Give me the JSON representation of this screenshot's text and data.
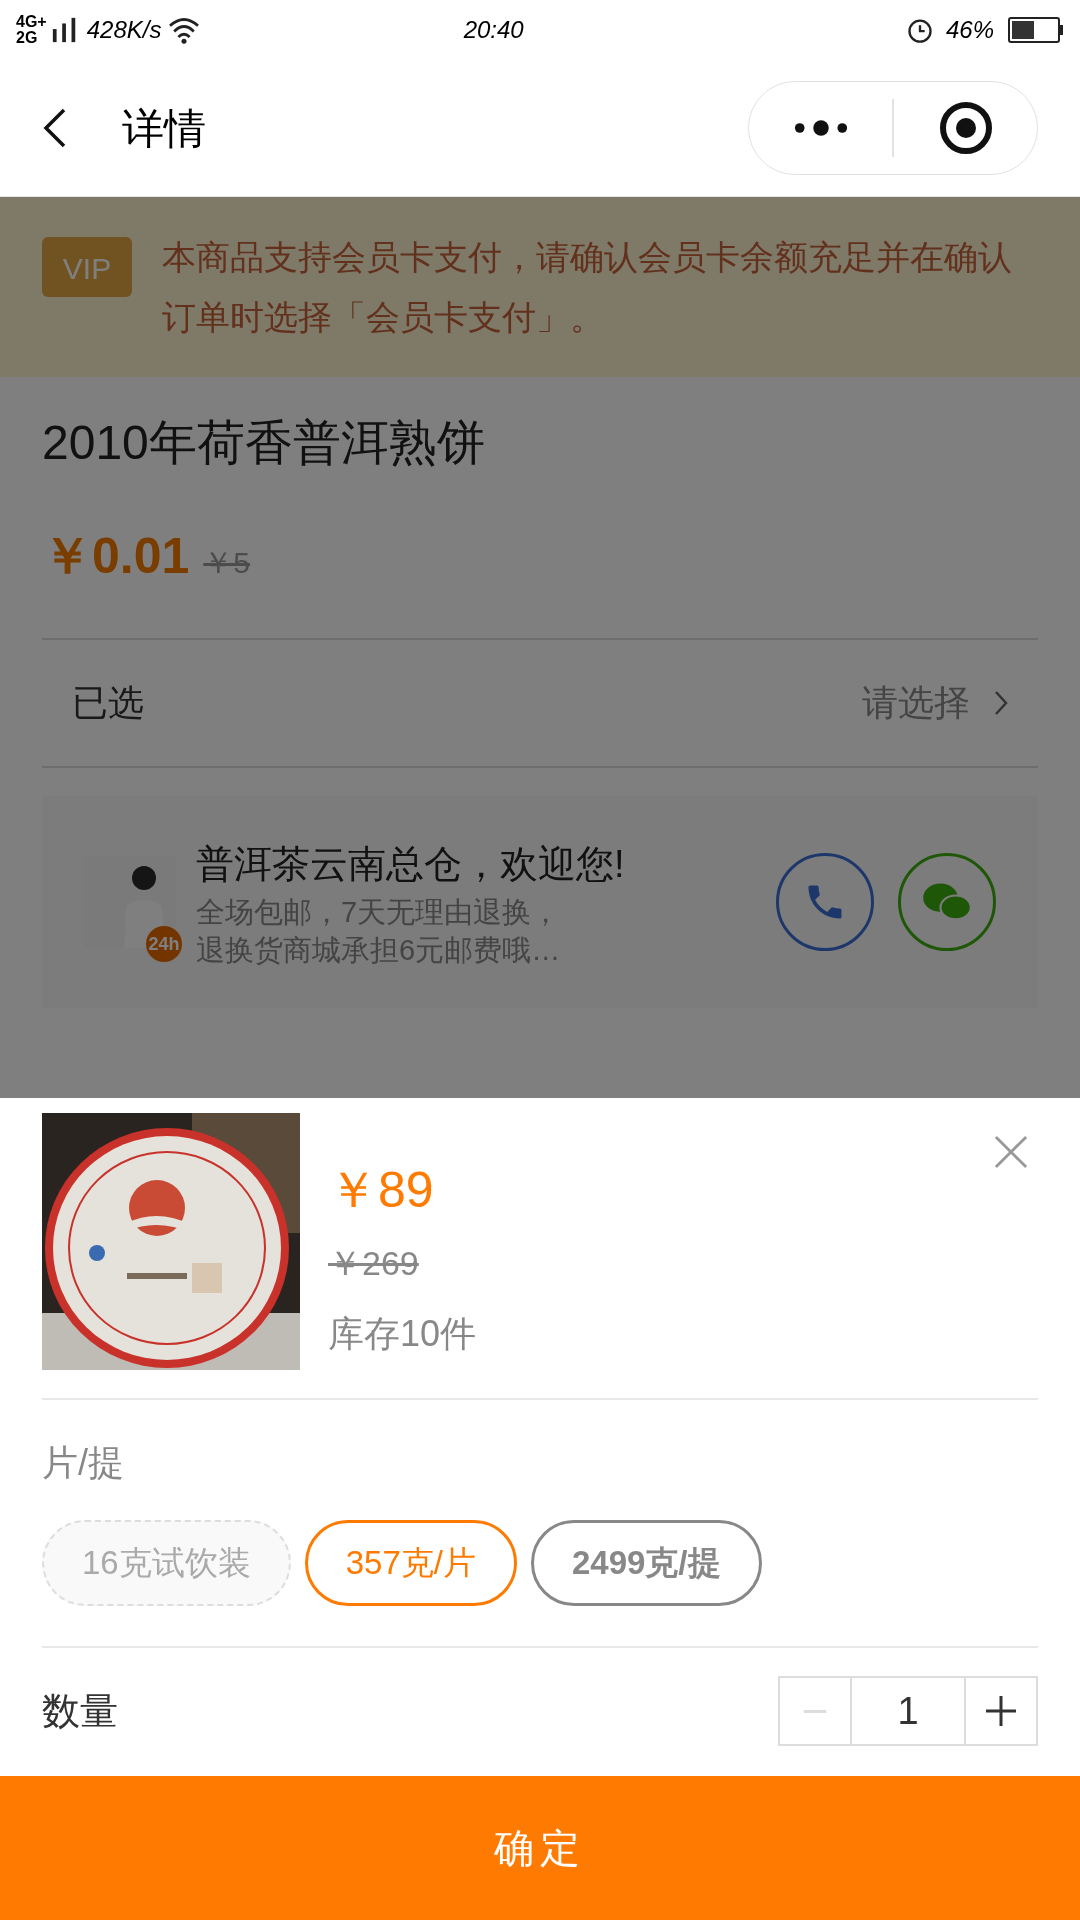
{
  "status_bar": {
    "network": [
      "4G+",
      "2G"
    ],
    "speed": "428K/s",
    "time": "20:40",
    "battery": "46%"
  },
  "nav": {
    "title": "详情"
  },
  "vip_notice": {
    "badge": "VIP",
    "text": "本商品支持会员卡支付，请确认会员卡余额充足并在确认订单时选择「会员卡支付」。"
  },
  "product": {
    "title": "2010年荷香普洱熟饼",
    "price": "￥0.01",
    "original_price": "￥5"
  },
  "selection_row": {
    "label": "已选",
    "value": "请选择"
  },
  "service": {
    "badge": "24h",
    "title": "普洱茶云南总仓，欢迎您!",
    "lines": [
      "全场包邮，7天无理由退换，",
      "退换货商城承担6元邮费哦…"
    ]
  },
  "sheet": {
    "price": "￥89",
    "original_price": "￥269",
    "stock": "库存10件",
    "spec_label": "片/提",
    "options": [
      {
        "label": "16克试饮装",
        "selected": false,
        "disabled": true
      },
      {
        "label": "357克/片",
        "selected": true,
        "disabled": false
      },
      {
        "label": "2499克/提",
        "selected": false,
        "disabled": false
      }
    ],
    "quantity": {
      "label": "数量",
      "value": "1",
      "decrease_disabled": true
    },
    "confirm": "确定"
  }
}
